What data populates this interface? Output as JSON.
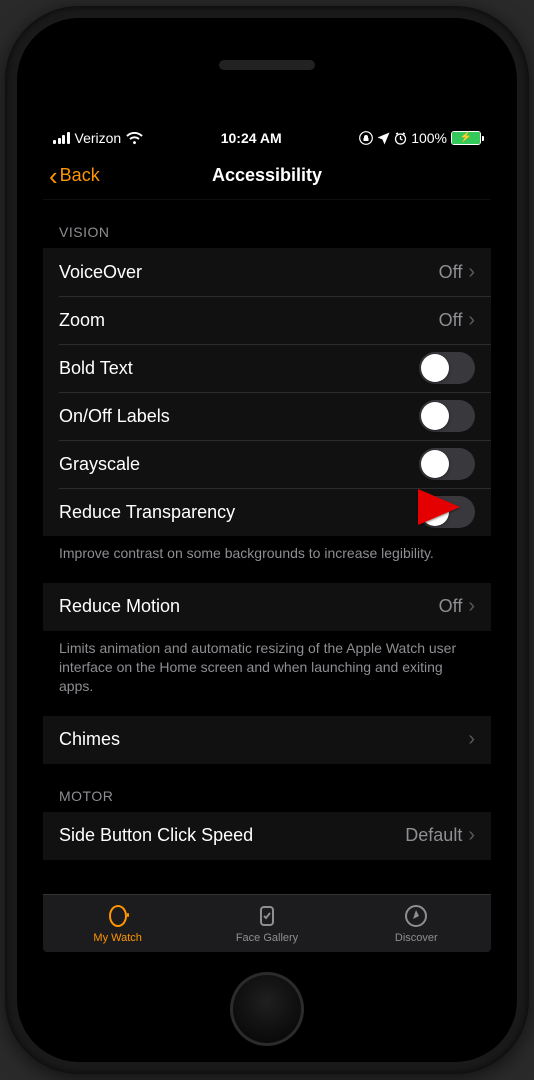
{
  "status": {
    "carrier": "Verizon",
    "time": "10:24 AM",
    "battery_pct": "100%"
  },
  "nav": {
    "back_label": "Back",
    "title": "Accessibility"
  },
  "sections": {
    "vision_header": "VISION",
    "voiceover": {
      "label": "VoiceOver",
      "value": "Off"
    },
    "zoom": {
      "label": "Zoom",
      "value": "Off"
    },
    "bold_text": {
      "label": "Bold Text"
    },
    "onoff_labels": {
      "label": "On/Off Labels"
    },
    "grayscale": {
      "label": "Grayscale"
    },
    "reduce_transparency": {
      "label": "Reduce Transparency"
    },
    "vision_footer": "Improve contrast on some backgrounds to increase legibility.",
    "reduce_motion": {
      "label": "Reduce Motion",
      "value": "Off"
    },
    "motion_footer": "Limits animation and automatic resizing of the Apple Watch user interface on the Home screen and when launching and exiting apps.",
    "chimes": {
      "label": "Chimes"
    },
    "motor_header": "MOTOR",
    "side_button": {
      "label": "Side Button Click Speed",
      "value": "Default"
    }
  },
  "tabs": {
    "my_watch": "My Watch",
    "face_gallery": "Face Gallery",
    "discover": "Discover"
  }
}
